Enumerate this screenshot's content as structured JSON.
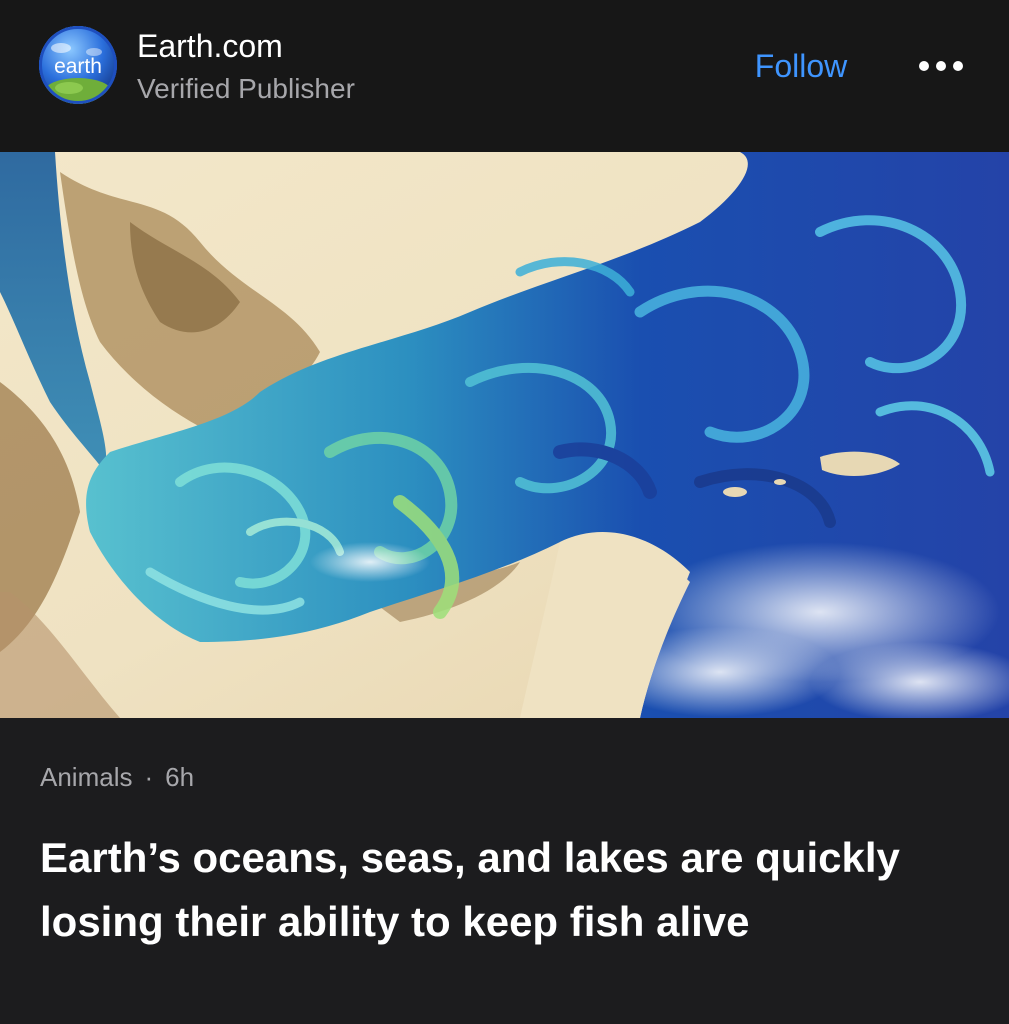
{
  "publisher": {
    "logo_text": "earth",
    "name": "Earth.com",
    "status": "Verified Publisher",
    "follow_label": "Follow",
    "more_icon": "ellipsis-icon"
  },
  "hero_image": {
    "subject": "satellite-ocean-phytoplankton-bloom"
  },
  "article": {
    "category": "Animals",
    "separator": "·",
    "age": "6h",
    "headline": "Earth’s oceans, seas, and lakes are quickly losing their ability to keep fish alive"
  },
  "colors": {
    "background": "#1c1c1e",
    "accent": "#3f95ff",
    "secondary_text": "#a7a7ab"
  }
}
